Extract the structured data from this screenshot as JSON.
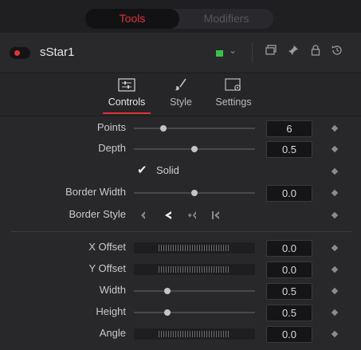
{
  "top_tabs": {
    "tools": "Tools",
    "modifiers": "Modifiers"
  },
  "node": {
    "name": "sStar1",
    "color": "#3cc04a"
  },
  "subtabs": [
    {
      "label": "Controls",
      "icon": "sliders-icon"
    },
    {
      "label": "Style",
      "icon": "brush-icon"
    },
    {
      "label": "Settings",
      "icon": "settings-panel-icon"
    }
  ],
  "params": {
    "points": {
      "label": "Points",
      "value": "6",
      "slider": 0.24
    },
    "depth": {
      "label": "Depth",
      "value": "0.5",
      "slider": 0.5
    },
    "solid": {
      "label": "Solid",
      "checked": true
    },
    "border_width": {
      "label": "Border Width",
      "value": "0.0",
      "slider": 0.5
    },
    "border_style": {
      "label": "Border Style"
    },
    "x_offset": {
      "label": "X Offset",
      "value": "0.0"
    },
    "y_offset": {
      "label": "Y Offset",
      "value": "0.0"
    },
    "width": {
      "label": "Width",
      "value": "0.5",
      "slider": 0.27
    },
    "height": {
      "label": "Height",
      "value": "0.5",
      "slider": 0.27
    },
    "angle": {
      "label": "Angle",
      "value": "0.0"
    }
  }
}
